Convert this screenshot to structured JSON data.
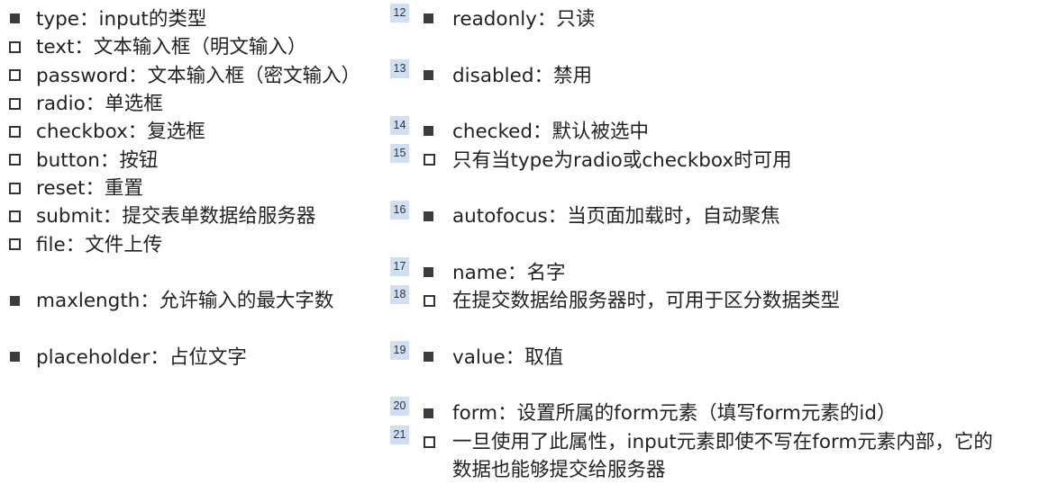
{
  "left_column": [
    {
      "bullet": "filled",
      "text": "type：input的类型"
    },
    {
      "bullet": "hollow",
      "text": "text：文本输入框（明文输入）"
    },
    {
      "bullet": "hollow",
      "text": "password：文本输入框（密文输入）"
    },
    {
      "bullet": "hollow",
      "text": "radio：单选框"
    },
    {
      "bullet": "hollow",
      "text": "checkbox：复选框"
    },
    {
      "bullet": "hollow",
      "text": "button：按钮"
    },
    {
      "bullet": "hollow",
      "text": "reset：重置"
    },
    {
      "bullet": "hollow",
      "text": "submit：提交表单数据给服务器"
    },
    {
      "bullet": "hollow",
      "text": "file：文件上传"
    },
    {
      "bullet": "filled",
      "text": "maxlength：允许输入的最大字数"
    },
    {
      "bullet": "filled",
      "text": "placeholder：占位文字"
    }
  ],
  "right_column": [
    {
      "number": "12",
      "bullet": "filled",
      "text": "readonly：只读"
    },
    {
      "number": "13",
      "bullet": "filled",
      "text": "disabled：禁用"
    },
    {
      "number": "14",
      "bullet": "filled",
      "text": "checked：默认被选中"
    },
    {
      "number": "15",
      "bullet": "hollow",
      "text": "只有当type为radio或checkbox时可用"
    },
    {
      "number": "16",
      "bullet": "filled",
      "text": "autofocus：当页面加载时，自动聚焦"
    },
    {
      "number": "17",
      "bullet": "filled",
      "text": "name：名字"
    },
    {
      "number": "18",
      "bullet": "hollow",
      "text": "在提交数据给服务器时，可用于区分数据类型"
    },
    {
      "number": "19",
      "bullet": "filled",
      "text": "value：取值"
    },
    {
      "number": "20",
      "bullet": "filled",
      "text": "form：设置所属的form元素（填写form元素的id）"
    },
    {
      "number": "21",
      "bullet": "hollow",
      "text": "一旦使用了此属性，input元素即使不写在form元素内部，它的",
      "text_cont": "数据也能够提交给服务器"
    }
  ]
}
